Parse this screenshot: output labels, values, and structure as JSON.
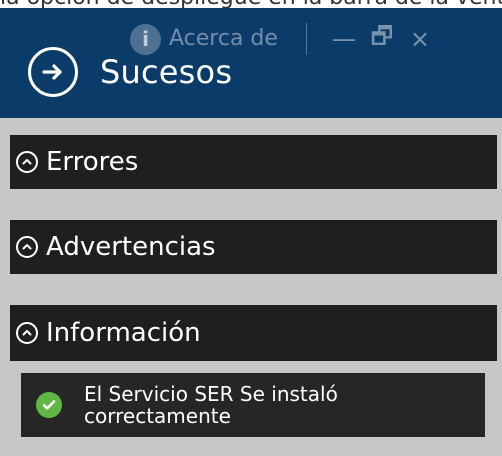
{
  "top_cut_text": "la opción de despliegue en la barra de la ventana",
  "window": {
    "about_label": "Acerca de",
    "title": "Sucesos",
    "controls": {
      "minimize": "—",
      "restore": "🗗",
      "close": "×"
    }
  },
  "sections": [
    {
      "label": "Errores"
    },
    {
      "label": "Advertencias"
    },
    {
      "label": "Información"
    }
  ],
  "events": [
    {
      "message": "El Servicio SER Se instaló correctamente"
    }
  ],
  "icons": {
    "about": "info-circle-icon",
    "header": "arrow-right-circle-icon",
    "collapse": "chevron-up-circle-icon",
    "success": "check-circle-icon"
  },
  "colors": {
    "titlebar": "#0b3b69",
    "panel": "#1f1f1f",
    "background": "#c7c7c7",
    "success": "#5fb843"
  }
}
